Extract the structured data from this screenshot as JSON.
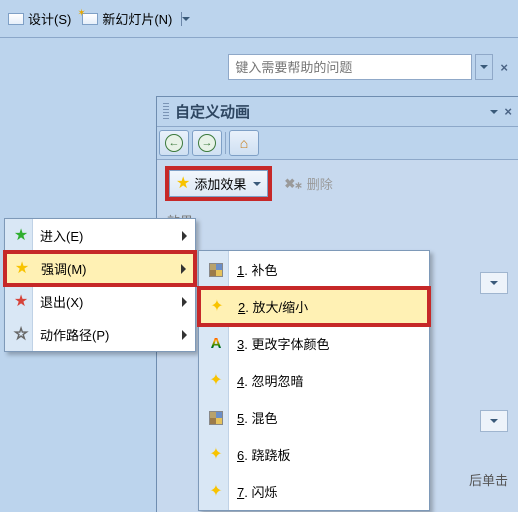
{
  "toolbar": {
    "design_label": "设计(S)",
    "new_slide_label": "新幻灯片(N)"
  },
  "help": {
    "placeholder": "键入需要帮助的问题"
  },
  "task_pane": {
    "title": "自定义动画",
    "add_effect_label": "添加效果",
    "delete_label": "删除",
    "modify_effect_label": "效果",
    "hint_tail": "后单击"
  },
  "context_menu": {
    "items": [
      {
        "label": "进入(E)",
        "iconColor": "green"
      },
      {
        "label": "强调(M)",
        "iconColor": "yellow"
      },
      {
        "label": "退出(X)",
        "iconColor": "red"
      },
      {
        "label": "动作路径(P)",
        "iconColor": "white"
      }
    ]
  },
  "sub_menu": {
    "items": [
      {
        "num": "1",
        "label": "补色",
        "icon": "swatch"
      },
      {
        "num": "2",
        "label": "放大/缩小",
        "icon": "star"
      },
      {
        "num": "3",
        "label": "更改字体颜色",
        "icon": "A"
      },
      {
        "num": "4",
        "label": "忽明忽暗",
        "icon": "star"
      },
      {
        "num": "5",
        "label": "混色",
        "icon": "swatch"
      },
      {
        "num": "6",
        "label": "跷跷板",
        "icon": "star"
      },
      {
        "num": "7",
        "label": "闪烁",
        "icon": "star"
      }
    ]
  }
}
